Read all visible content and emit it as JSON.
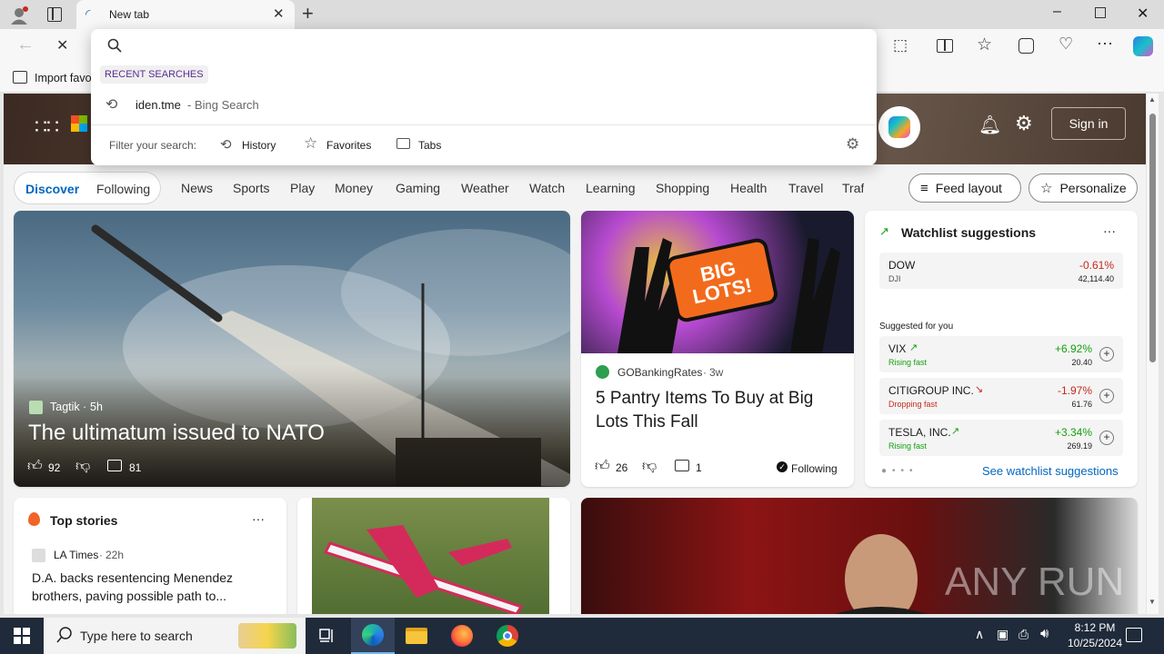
{
  "browser": {
    "tab_title": "New tab",
    "fav_import": "Import favo"
  },
  "omnibox": {
    "section_label": "RECENT SEARCHES",
    "recent_query": "iden.tme",
    "recent_suffix": "- Bing Search",
    "filter_label": "Filter your search:",
    "filters": [
      "History",
      "Favorites",
      "Tabs"
    ]
  },
  "header": {
    "sign_in": "Sign in"
  },
  "nav": {
    "pills": [
      "Discover",
      "Following"
    ],
    "items": [
      "News",
      "Sports",
      "Play",
      "Money",
      "Gaming",
      "Weather",
      "Watch",
      "Learning",
      "Shopping",
      "Health",
      "Travel",
      "Traf"
    ],
    "feed_layout": "Feed layout",
    "personalize": "Personalize"
  },
  "hero_article": {
    "source": "Tagtik",
    "age": "5h",
    "title": "The ultimatum issued to NATO",
    "likes": "92",
    "comments": "81"
  },
  "article2": {
    "image_text": "BIG LOTS!",
    "source": "GOBankingRates",
    "age": "3w",
    "title": "5 Pantry Items To Buy at Big Lots This Fall",
    "likes": "26",
    "comments": "1",
    "following": "Following"
  },
  "watchlist": {
    "title": "Watchlist suggestions",
    "more": "···",
    "dow": {
      "name": "DOW",
      "sub": "DJI",
      "change": "-0.61%",
      "value": "42,114.40"
    },
    "suggested_label": "Suggested for you",
    "stocks": [
      {
        "name": "VIX",
        "status": "Rising fast",
        "change": "+6.92%",
        "value": "20.40",
        "color": "#13a10e"
      },
      {
        "name": "CITIGROUP INC.",
        "status": "Dropping fast",
        "change": "-1.97%",
        "value": "61.76",
        "color": "#c42b1c"
      },
      {
        "name": "TESLA, INC.",
        "status": "Rising fast",
        "change": "+3.34%",
        "value": "269.19",
        "color": "#13a10e"
      }
    ],
    "see_more": "See watchlist suggestions"
  },
  "top_stories": {
    "title": "Top stories",
    "more": "···",
    "source": "LA Times",
    "age": "22h",
    "headline": "D.A. backs resentencing Menendez brothers, paving possible path to..."
  },
  "watermark": "ANY RUN",
  "taskbar": {
    "search_placeholder": "Type here to search",
    "time": "8:12 PM",
    "date": "10/25/2024"
  }
}
